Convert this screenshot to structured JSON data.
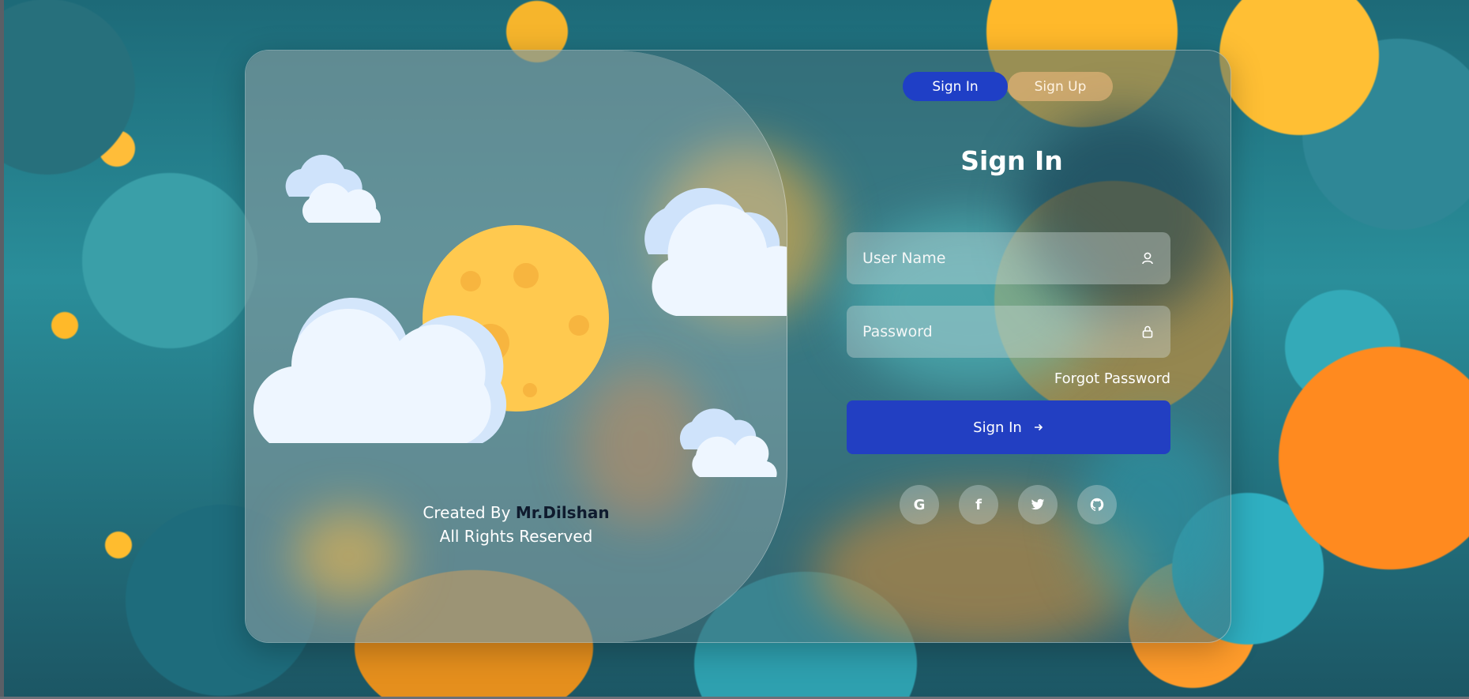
{
  "tabs": {
    "sign_in": "Sign In",
    "sign_up": "Sign Up"
  },
  "form": {
    "title": "Sign In",
    "username_placeholder": "User Name",
    "password_placeholder": "Password",
    "forgot_password": "Forgot Password",
    "submit_label": "Sign In"
  },
  "socials": {
    "google": "G",
    "facebook": "f"
  },
  "credits": {
    "created_by": "Created By",
    "author": "Mr.Dilshan",
    "rights": "All Rights Reserved"
  },
  "colors": {
    "primary_button": "#223fc2",
    "tab_inactive": "#f5be82",
    "sun": "#ffc94f",
    "cloud": "#eef6ff"
  },
  "icons": [
    "user-icon",
    "lock-icon",
    "arrow-right-icon",
    "google-icon",
    "facebook-icon",
    "twitter-icon",
    "github-icon",
    "cloud-icon",
    "sun-icon"
  ]
}
